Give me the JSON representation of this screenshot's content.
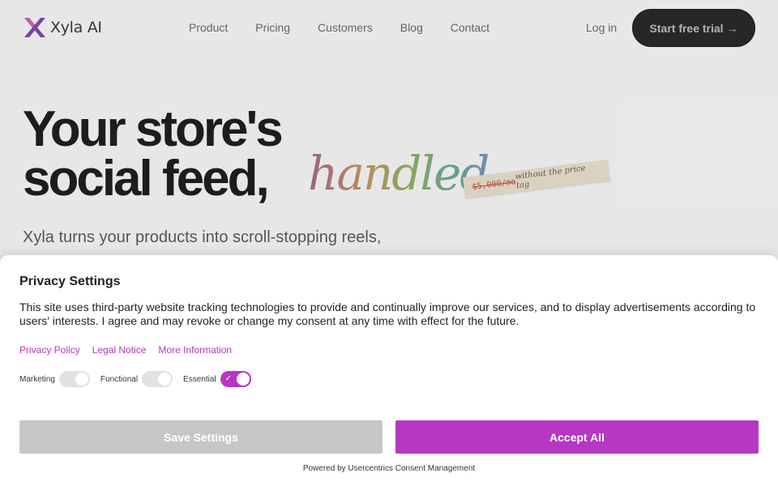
{
  "nav": {
    "logo_text": "Xyla AI",
    "links": [
      "Product",
      "Pricing",
      "Customers",
      "Blog",
      "Contact"
    ],
    "login_label": "Log in",
    "cta_label": "Start free trial →"
  },
  "hero": {
    "line1": "Your store's",
    "line2": "social feed,",
    "accent_word": "handled.",
    "price_tag_old": "$5,000/mo",
    "price_tag_note": "without the price tag",
    "subtitle": "Xyla turns your products into scroll-stopping reels,"
  },
  "consent": {
    "title": "Privacy Settings",
    "description": "This site uses third-party website tracking technologies to provide and continually improve our services, and to display advertisements according to users' interests. I agree and may revoke or change my consent at any time with effect for the future.",
    "links": [
      "Privacy Policy",
      "Legal Notice",
      "More Information"
    ],
    "toggles": [
      {
        "label": "Marketing",
        "on": false
      },
      {
        "label": "Functional",
        "on": false
      },
      {
        "label": "Essential",
        "on": true
      }
    ],
    "save_label": "Save Settings",
    "accept_label": "Accept All",
    "powered_by": "Powered by Usercentrics Consent Management"
  },
  "colors": {
    "accent": "#b637c2",
    "cta_bg": "#2a2a2a",
    "save_bg": "#c6c6c6"
  }
}
